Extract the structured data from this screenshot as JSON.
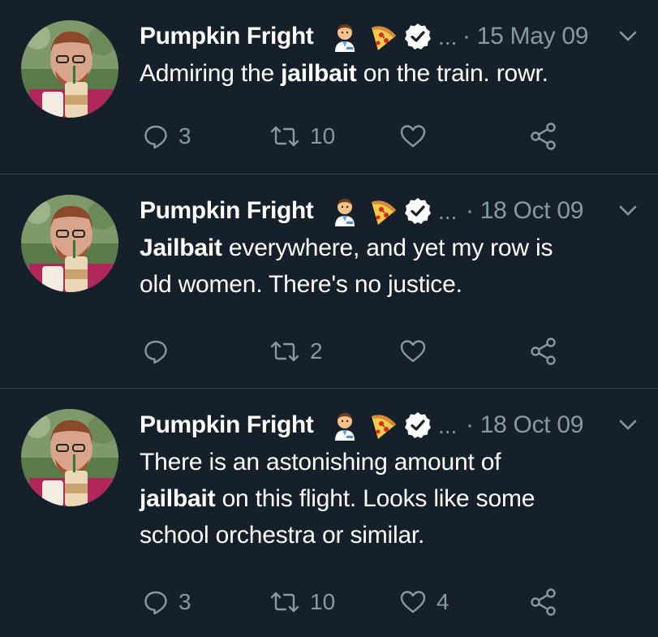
{
  "user": {
    "name": "Pumpkin Fright",
    "emoji_icons": [
      "man-health-worker-emoji",
      "pizza-emoji"
    ],
    "verified": true,
    "colors": {
      "background": "#15202b",
      "divider": "#38444d",
      "secondary_text": "#8899a6",
      "verified_badge": "#ffffff"
    }
  },
  "tweets": [
    {
      "handle": "...",
      "date": "· 15 May 09",
      "body": [
        {
          "text": "Admiring the ",
          "bold": false
        },
        {
          "text": "jailbait",
          "bold": true
        },
        {
          "text": " on the train. rowr.",
          "bold": false
        }
      ],
      "replies": "3",
      "retweets": "10",
      "likes": ""
    },
    {
      "handle": "...",
      "date": "· 18 Oct 09",
      "body": [
        {
          "text": "Jailbait",
          "bold": true
        },
        {
          "text": " everywhere, and yet my row is",
          "bold": false
        },
        {
          "text": "\n",
          "bold": false
        },
        {
          "text": "old women. There's no justice.",
          "bold": false
        }
      ],
      "replies": "",
      "retweets": "2",
      "likes": ""
    },
    {
      "handle": "...",
      "date": "· 18 Oct 09",
      "body": [
        {
          "text": "There is an astonishing amount of",
          "bold": false
        },
        {
          "text": "\n",
          "bold": false
        },
        {
          "text": "jailbait",
          "bold": true
        },
        {
          "text": " on this flight. Looks like some",
          "bold": false
        },
        {
          "text": "\n",
          "bold": false
        },
        {
          "text": "school orchestra or similar.",
          "bold": false
        }
      ],
      "replies": "3",
      "retweets": "10",
      "likes": "4"
    }
  ]
}
